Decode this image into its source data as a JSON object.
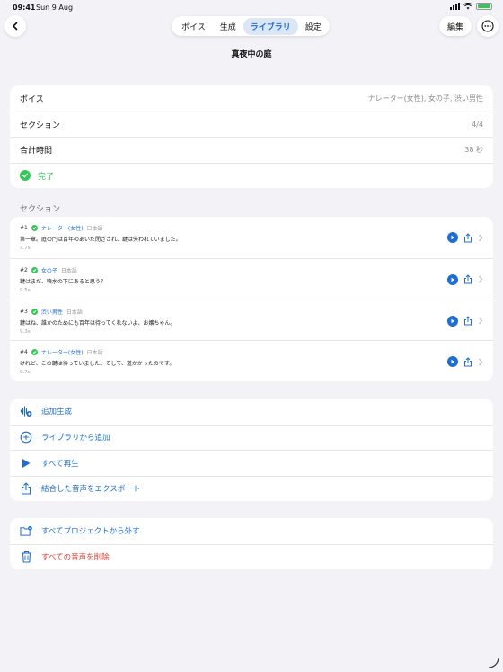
{
  "status": {
    "time": "09:41",
    "date": "Sun 9 Aug"
  },
  "nav": {
    "tabs": [
      {
        "label": "ボイス",
        "active": false
      },
      {
        "label": "生成",
        "active": false
      },
      {
        "label": "ライブラリ",
        "active": true
      },
      {
        "label": "設定",
        "active": false
      }
    ],
    "edit_label": "編集"
  },
  "page": {
    "title": "真夜中の庭"
  },
  "summary": {
    "voice_label": "ボイス",
    "voice_value": "ナレーター(女性), 女の子, 渋い男性",
    "sections_label": "セクション",
    "sections_value": "4/4",
    "total_label": "合計時間",
    "total_value": "38 秒",
    "status_label": "完了"
  },
  "sections_header": "セクション",
  "sections": [
    {
      "num": "#1",
      "voice": "ナレーター(女性)",
      "lang": "日本語",
      "text": "第一章。庭の門は百年のあいだ閉ざされ、鍵は失われていました。",
      "duration": "9.7s"
    },
    {
      "num": "#2",
      "voice": "女の子",
      "lang": "日本語",
      "text": "鍵はまだ、噴水の下にあると思う？",
      "duration": "9.5s"
    },
    {
      "num": "#3",
      "voice": "渋い男性",
      "lang": "日本語",
      "text": "鍵はね、誰かのためにも百年は待ってくれないよ、お嬢ちゃん。",
      "duration": "9.3s"
    },
    {
      "num": "#4",
      "voice": "ナレーター(女性)",
      "lang": "日本語",
      "text": "けれど、この鍵は待っていました。そして、道かかったのです。",
      "duration": "9.7s"
    }
  ],
  "actions": {
    "generate_more": "追加生成",
    "add_from_library": "ライブラリから追加",
    "play_all": "すべて再生",
    "export_merged": "結合した音声をエクスポート"
  },
  "danger": {
    "remove_from_projects": "すべてプロジェクトから外す",
    "delete_all_audio": "すべての音声を削除"
  },
  "colors": {
    "accent": "#1f6fd1",
    "success": "#34c759",
    "danger": "#e5413a",
    "background": "#f2f2f7"
  }
}
